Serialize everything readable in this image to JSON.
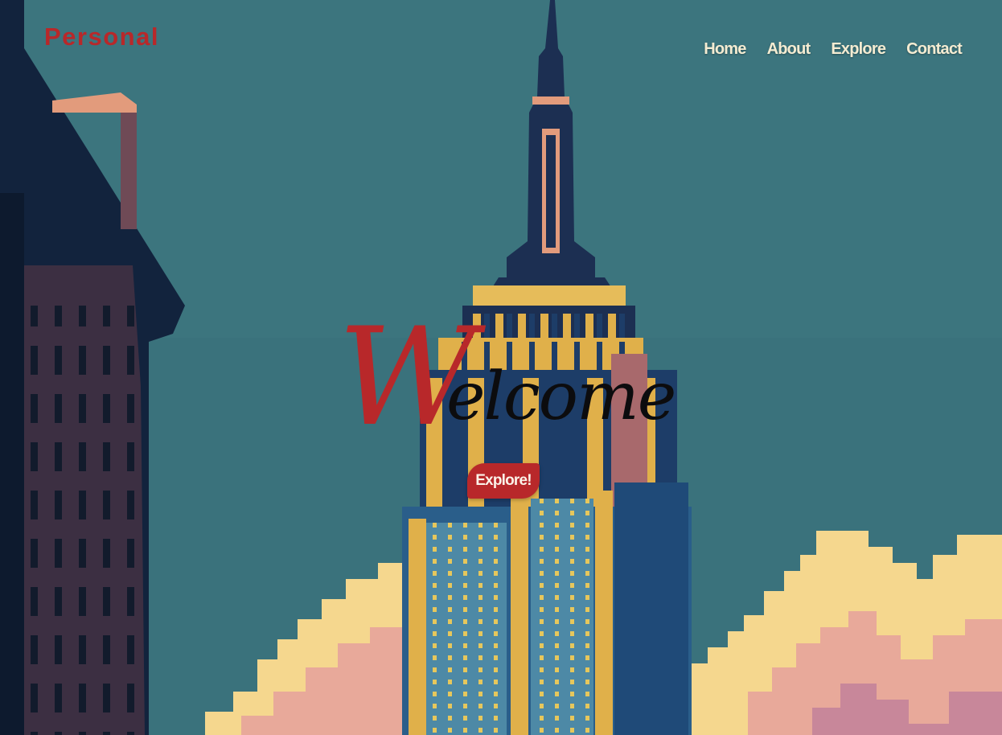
{
  "site": {
    "brand": "Personal"
  },
  "nav": {
    "items": [
      {
        "label": "Home"
      },
      {
        "label": "About"
      },
      {
        "label": "Explore"
      },
      {
        "label": "Contact"
      }
    ]
  },
  "hero": {
    "title_initial": "W",
    "title_rest": "elcome",
    "cta_label": "Explore!",
    "background": "empire-state-building-illustration"
  },
  "colors": {
    "accent": "#b8282a",
    "sky": "#3a727c",
    "nav_text": "#f4ecd2",
    "title_dark": "#0c0c0e"
  }
}
